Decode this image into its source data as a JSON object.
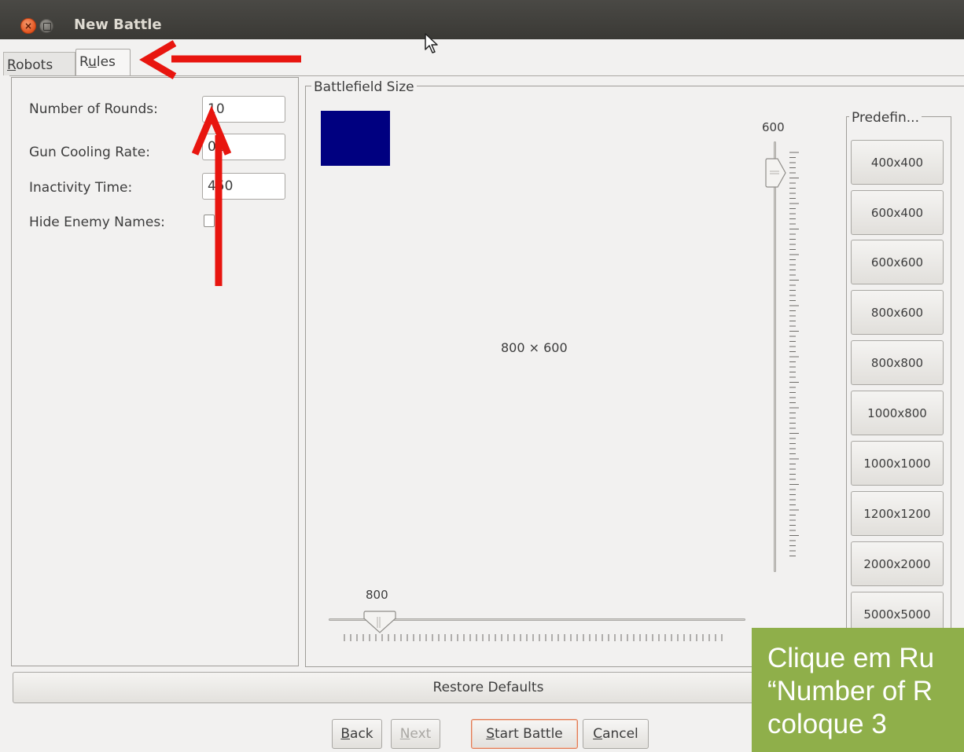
{
  "window": {
    "title": "New Battle"
  },
  "tabs": {
    "robots": {
      "pre": "",
      "mn": "R",
      "post": "obots"
    },
    "rules": {
      "pre": "R",
      "mn": "u",
      "post": "les"
    }
  },
  "rules": {
    "rounds_label": "Number of Rounds:",
    "rounds_value": "10",
    "cooling_label": "Gun Cooling Rate:",
    "cooling_value": "0.1",
    "inactivity_label": "Inactivity Time:",
    "inactivity_value": "450",
    "hide_label": "Hide Enemy Names:"
  },
  "battlefield": {
    "legend": "Battlefield Size",
    "size_label": "800 × 600",
    "height_value": "600",
    "width_value": "800",
    "preview_color": "#000080"
  },
  "predefined": {
    "legend": "Predefin...",
    "sizes": [
      "400x400",
      "600x400",
      "600x600",
      "800x600",
      "800x800",
      "1000x800",
      "1000x1000",
      "1200x1200",
      "2000x2000",
      "5000x5000"
    ]
  },
  "buttons": {
    "restore": "Restore Defaults",
    "back": {
      "mn": "B",
      "post": "ack"
    },
    "next": {
      "mn": "N",
      "post": "ext"
    },
    "start": {
      "mn": "S",
      "post": "tart Battle"
    },
    "cancel": {
      "mn": "C",
      "post": "ancel"
    }
  },
  "caption": {
    "text": "Clique em Ru\n“Number of R\ncoloque 3",
    "color": "#8faf4a"
  },
  "annotation_color": "#e8150f"
}
